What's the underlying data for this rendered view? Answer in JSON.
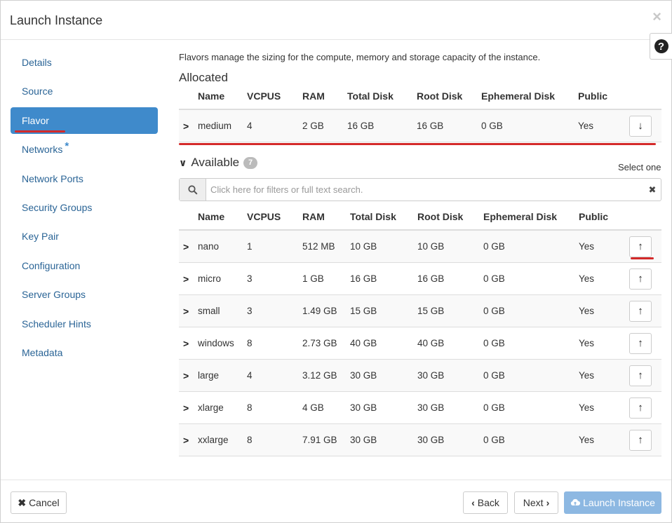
{
  "dialog": {
    "title": "Launch Instance",
    "close_glyph": "×",
    "help_glyph": "?"
  },
  "sidebar": {
    "items": [
      {
        "label": "Details"
      },
      {
        "label": "Source"
      },
      {
        "label": "Flavor",
        "active": true
      },
      {
        "label": "Networks",
        "required": "*"
      },
      {
        "label": "Network Ports"
      },
      {
        "label": "Security Groups"
      },
      {
        "label": "Key Pair"
      },
      {
        "label": "Configuration"
      },
      {
        "label": "Server Groups"
      },
      {
        "label": "Scheduler Hints"
      },
      {
        "label": "Metadata"
      }
    ]
  },
  "main": {
    "intro": "Flavors manage the sizing for the compute, memory and storage capacity of the instance.",
    "allocated_title": "Allocated",
    "columns": [
      "Name",
      "VCPUS",
      "RAM",
      "Total Disk",
      "Root Disk",
      "Ephemeral Disk",
      "Public"
    ],
    "allocated": [
      {
        "name": "medium",
        "vcpus": "4",
        "ram": "2 GB",
        "total_disk": "16 GB",
        "root_disk": "16 GB",
        "ephemeral_disk": "0 GB",
        "public": "Yes"
      }
    ],
    "available_title": "Available",
    "available_count": "7",
    "select_one": "Select one",
    "search_placeholder": "Click here for filters or full text search.",
    "available": [
      {
        "name": "nano",
        "vcpus": "1",
        "ram": "512 MB",
        "total_disk": "10 GB",
        "root_disk": "10 GB",
        "ephemeral_disk": "0 GB",
        "public": "Yes"
      },
      {
        "name": "micro",
        "vcpus": "3",
        "ram": "1 GB",
        "total_disk": "16 GB",
        "root_disk": "16 GB",
        "ephemeral_disk": "0 GB",
        "public": "Yes"
      },
      {
        "name": "small",
        "vcpus": "3",
        "ram": "1.49 GB",
        "total_disk": "15 GB",
        "root_disk": "15 GB",
        "ephemeral_disk": "0 GB",
        "public": "Yes"
      },
      {
        "name": "windows",
        "vcpus": "8",
        "ram": "2.73 GB",
        "total_disk": "40 GB",
        "root_disk": "40 GB",
        "ephemeral_disk": "0 GB",
        "public": "Yes"
      },
      {
        "name": "large",
        "vcpus": "4",
        "ram": "3.12 GB",
        "total_disk": "30 GB",
        "root_disk": "30 GB",
        "ephemeral_disk": "0 GB",
        "public": "Yes"
      },
      {
        "name": "xlarge",
        "vcpus": "8",
        "ram": "4 GB",
        "total_disk": "30 GB",
        "root_disk": "30 GB",
        "ephemeral_disk": "0 GB",
        "public": "Yes"
      },
      {
        "name": "xxlarge",
        "vcpus": "8",
        "ram": "7.91 GB",
        "total_disk": "30 GB",
        "root_disk": "30 GB",
        "ephemeral_disk": "0 GB",
        "public": "Yes"
      }
    ]
  },
  "footer": {
    "cancel_label": "Cancel",
    "back_label": "Back",
    "next_label": "Next",
    "launch_label": "Launch Instance"
  },
  "colors": {
    "accent": "#3f8acb",
    "annotation": "#d42a2a",
    "link": "#2a6496",
    "primary_disabled": "#8db8e2"
  }
}
